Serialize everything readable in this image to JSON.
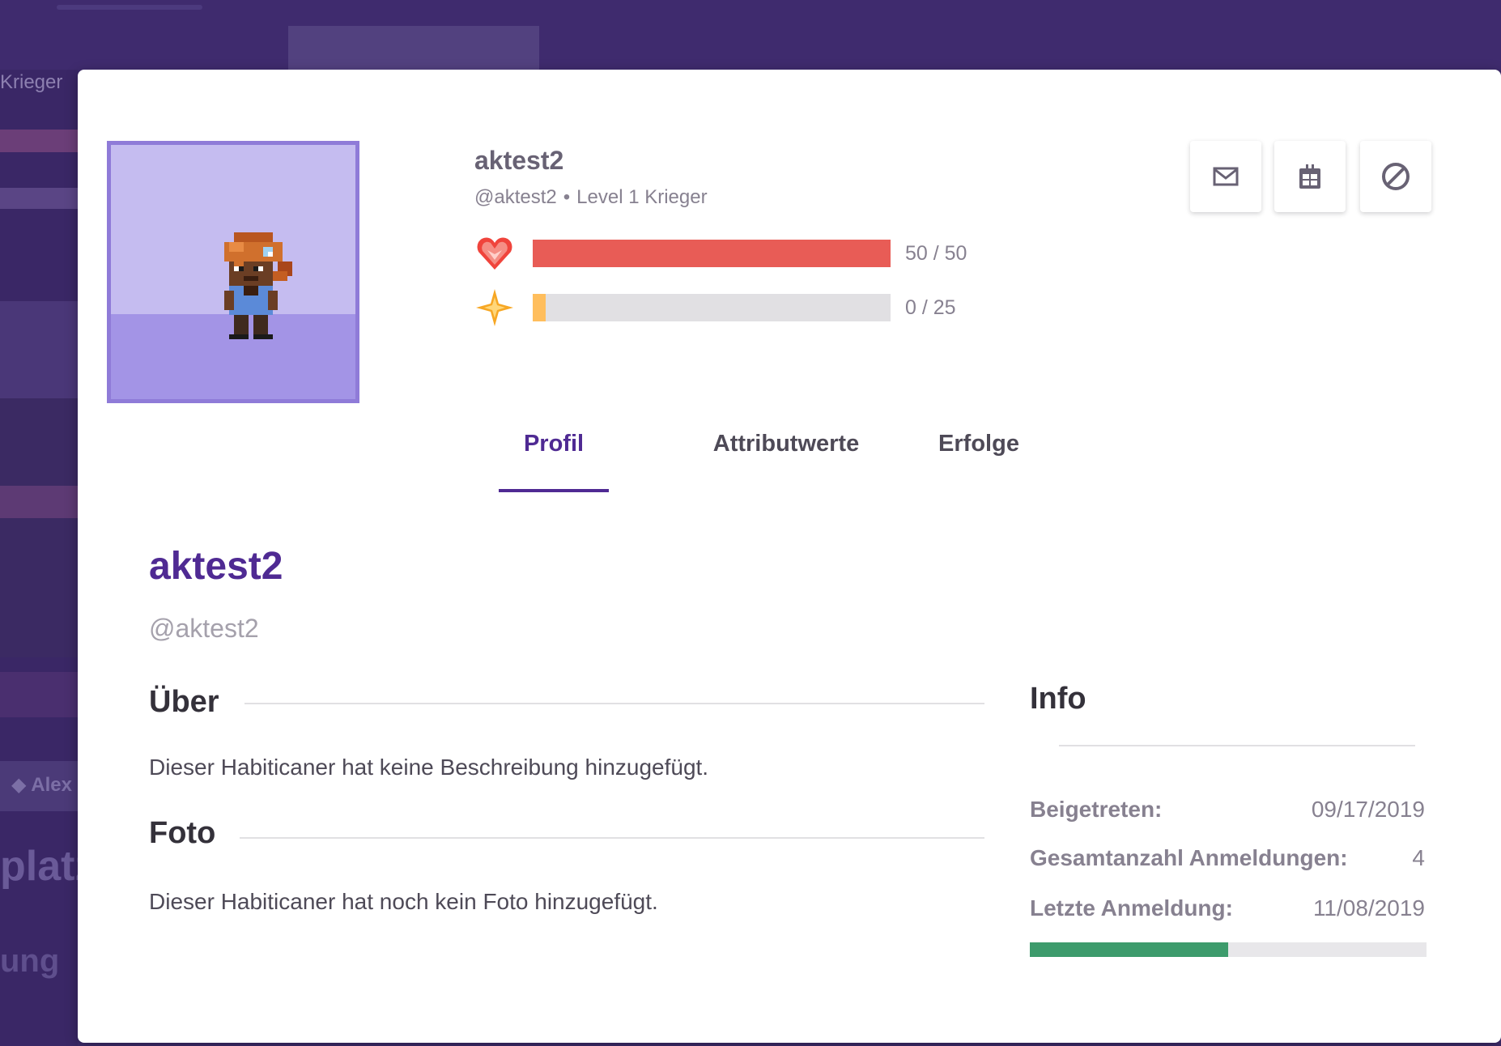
{
  "background": {
    "sidebar_label": "Krieger",
    "member_name": "Alex",
    "big_text_1": "platz",
    "big_text_2": "ung"
  },
  "header": {
    "username": "aktest2",
    "handle": "@aktest2",
    "separator": "•",
    "level_class": "Level 1 Krieger"
  },
  "stats": {
    "health": {
      "icon": "heart-icon",
      "current": 50,
      "max": 50,
      "text": "50 / 50",
      "color": "#e85c56",
      "fraction": 1.0
    },
    "experience": {
      "icon": "star-icon",
      "current": 0,
      "max": 25,
      "text": "0 / 25",
      "color": "#ffbe5d",
      "fraction": 0.0
    }
  },
  "actions": [
    {
      "name": "message-button",
      "icon": "envelope-icon"
    },
    {
      "name": "gift-button",
      "icon": "gift-icon"
    },
    {
      "name": "block-button",
      "icon": "block-icon"
    }
  ],
  "tabs": [
    {
      "label": "Profil",
      "active": true
    },
    {
      "label": "Attributwerte",
      "active": false
    },
    {
      "label": "Erfolge",
      "active": false
    }
  ],
  "profile": {
    "name": "aktest2",
    "handle": "@aktest2",
    "about_title": "Über",
    "about_text": "Dieser Habiticaner hat keine Beschreibung hinzugefügt.",
    "photo_title": "Foto",
    "photo_text": "Dieser Habiticaner hat noch kein Foto hinzugefügt."
  },
  "info": {
    "title": "Info",
    "rows": [
      {
        "label": "Beigetreten:",
        "value": "09/17/2019"
      },
      {
        "label": "Gesamtanzahl Anmeldungen:",
        "value": "4"
      },
      {
        "label": "Letzte Anmeldung:",
        "value": "11/08/2019"
      }
    ],
    "progress_fraction": 0.5,
    "progress_color": "#3d9b6c"
  },
  "colors": {
    "brand_purple": "#4f2a93",
    "background_purple": "#3d2b6b",
    "avatar_border": "#8f7bd8"
  }
}
